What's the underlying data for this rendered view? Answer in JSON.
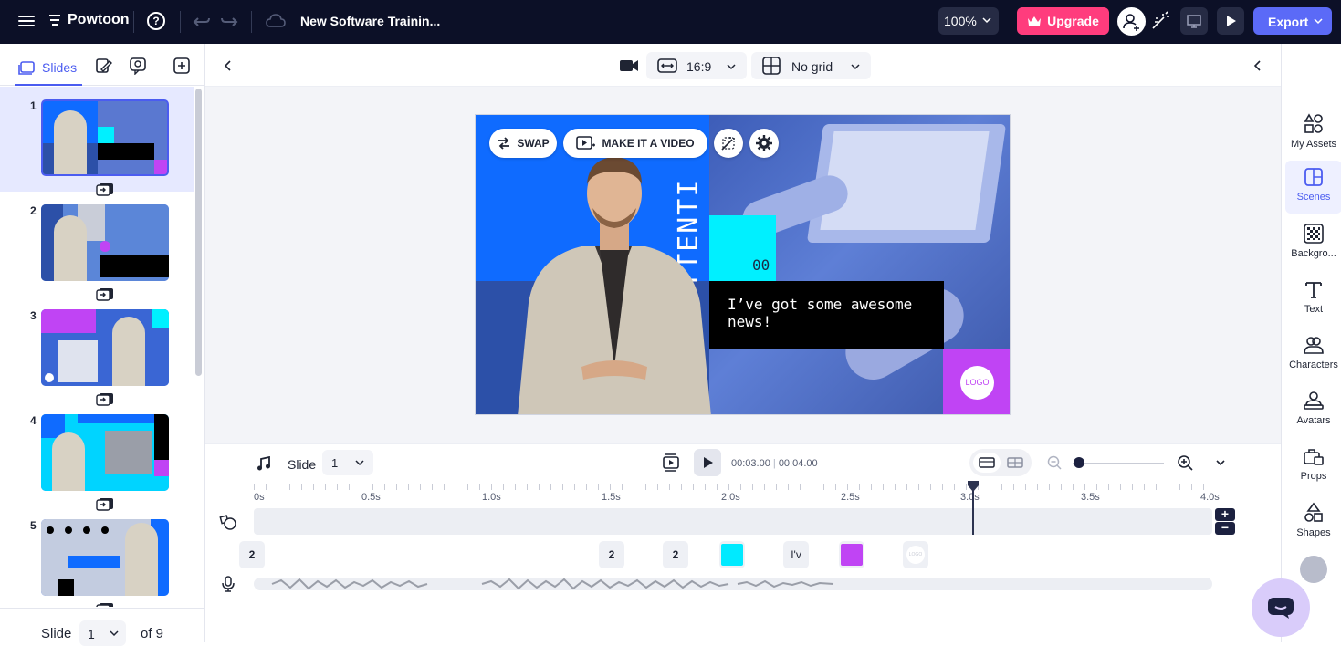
{
  "app": {
    "name": "Powtoon",
    "project_title": "New Software Trainin...",
    "zoom": "100%",
    "upgrade_label": "Upgrade",
    "export_label": "Export",
    "help_glyph": "?"
  },
  "left_panel": {
    "tabs": [
      {
        "name": "slides",
        "label": "Slides",
        "icon": "slides-icon"
      },
      {
        "name": "notes",
        "icon": "notes-icon"
      },
      {
        "name": "comments",
        "icon": "comments-icon"
      },
      {
        "name": "add",
        "icon": "add-slide-icon"
      }
    ],
    "slides": [
      {
        "num": "1",
        "selected": true
      },
      {
        "num": "2"
      },
      {
        "num": "3"
      },
      {
        "num": "4"
      },
      {
        "num": "5"
      }
    ],
    "footer": {
      "label": "Slide",
      "current": "1",
      "of": "of 9"
    }
  },
  "canvas_bar": {
    "ratio": "16:9",
    "grid": "No grid"
  },
  "slide": {
    "actions": {
      "swap": "SWAP",
      "make_video": "MAKE IT A VIDEO"
    },
    "vertical_text": "ATTENTI",
    "cyan_text": "00",
    "caption": "I’ve got some awesome news!",
    "logo": "LOGO"
  },
  "timeline": {
    "slide_label": "Slide",
    "slide_value": "1",
    "current_time": "00:03.00",
    "total_time": "00:04.00",
    "ticks": [
      "0s",
      "0.5s",
      "1.0s",
      "1.5s",
      "2.0s",
      "2.5s",
      "3.0s",
      "3.5s",
      "4.0s"
    ],
    "playhead_time": "3.0s",
    "chips": [
      {
        "kind": "text",
        "label": "2"
      },
      {
        "kind": "text",
        "label": "2"
      },
      {
        "kind": "text",
        "label": "2"
      },
      {
        "kind": "color",
        "color": "#00eaff"
      },
      {
        "kind": "text",
        "label": "I'v"
      },
      {
        "kind": "color",
        "color": "#c044f4"
      },
      {
        "kind": "logo",
        "label": "LOGO"
      }
    ],
    "plus": "+",
    "minus": "−"
  },
  "right_panel": {
    "items": [
      {
        "name": "my-assets",
        "label": "My Assets",
        "icon": "assets-icon"
      },
      {
        "name": "scenes",
        "label": "Scenes",
        "icon": "scenes-icon",
        "active": true
      },
      {
        "name": "background",
        "label": "Backgro...",
        "icon": "background-icon"
      },
      {
        "name": "text",
        "label": "Text",
        "icon": "text-icon"
      },
      {
        "name": "characters",
        "label": "Characters",
        "icon": "characters-icon"
      },
      {
        "name": "avatars",
        "label": "Avatars",
        "icon": "avatars-icon"
      },
      {
        "name": "props",
        "label": "Props",
        "icon": "props-icon"
      },
      {
        "name": "shapes",
        "label": "Shapes",
        "icon": "shapes-icon"
      }
    ]
  },
  "colors": {
    "topbar": "#0c1027",
    "accent": "#4b5cf0",
    "upgrade": "#ff3c7d",
    "export": "#5b6af7",
    "slide_blue": "#0f6bff",
    "slide_cyan": "#00f0ff",
    "slide_purple": "#c044f4"
  }
}
